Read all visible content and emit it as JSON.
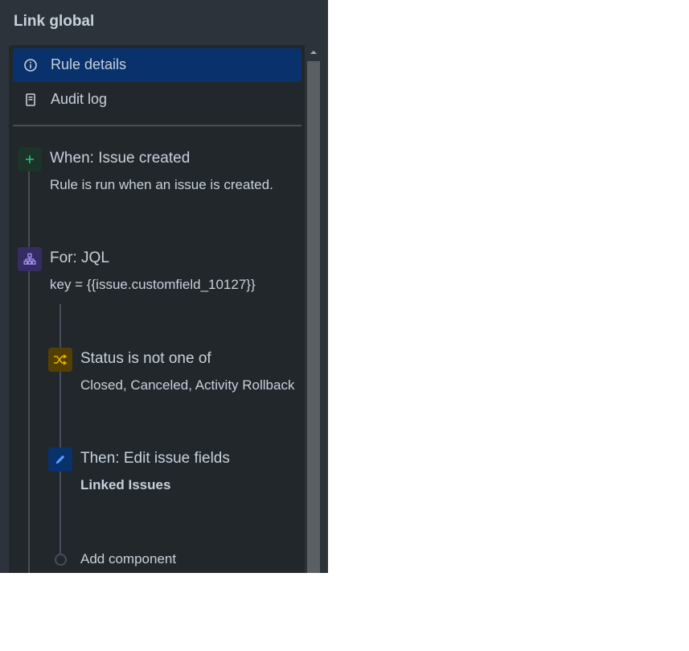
{
  "panel": {
    "title": "Link global"
  },
  "nav": {
    "items": [
      {
        "label": "Rule details",
        "icon": "info-icon",
        "active": true
      },
      {
        "label": "Audit log",
        "icon": "document-icon",
        "active": false
      }
    ]
  },
  "steps": [
    {
      "icon": "plus-icon",
      "title": "When: Issue created",
      "description": "Rule is run when an issue is created.",
      "color": "#1c3329",
      "accent": "#2abb7f"
    },
    {
      "icon": "branch-icon",
      "title": "For: JQL",
      "description": "key = {{issue.customfield_10127}}",
      "color": "#352c63",
      "accent": "#9f8fef"
    },
    {
      "icon": "shuffle-icon",
      "title": "Status is not one of",
      "description": "Closed, Canceled, Activity Rollback",
      "color": "#533f04",
      "accent": "#e2b203"
    },
    {
      "icon": "pencil-icon",
      "title": "Then: Edit issue fields",
      "description": "Linked Issues",
      "color": "#09326c",
      "accent": "#579dff"
    }
  ],
  "add_component": {
    "label": "Add component"
  }
}
